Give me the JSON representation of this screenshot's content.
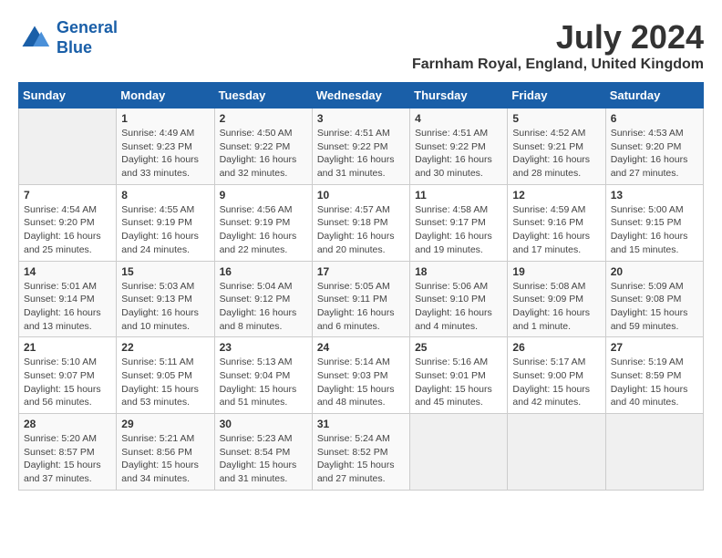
{
  "header": {
    "logo_line1": "General",
    "logo_line2": "Blue",
    "month": "July 2024",
    "location": "Farnham Royal, England, United Kingdom"
  },
  "weekdays": [
    "Sunday",
    "Monday",
    "Tuesday",
    "Wednesday",
    "Thursday",
    "Friday",
    "Saturday"
  ],
  "weeks": [
    [
      {
        "day": "",
        "info": ""
      },
      {
        "day": "1",
        "info": "Sunrise: 4:49 AM\nSunset: 9:23 PM\nDaylight: 16 hours\nand 33 minutes."
      },
      {
        "day": "2",
        "info": "Sunrise: 4:50 AM\nSunset: 9:22 PM\nDaylight: 16 hours\nand 32 minutes."
      },
      {
        "day": "3",
        "info": "Sunrise: 4:51 AM\nSunset: 9:22 PM\nDaylight: 16 hours\nand 31 minutes."
      },
      {
        "day": "4",
        "info": "Sunrise: 4:51 AM\nSunset: 9:22 PM\nDaylight: 16 hours\nand 30 minutes."
      },
      {
        "day": "5",
        "info": "Sunrise: 4:52 AM\nSunset: 9:21 PM\nDaylight: 16 hours\nand 28 minutes."
      },
      {
        "day": "6",
        "info": "Sunrise: 4:53 AM\nSunset: 9:20 PM\nDaylight: 16 hours\nand 27 minutes."
      }
    ],
    [
      {
        "day": "7",
        "info": "Sunrise: 4:54 AM\nSunset: 9:20 PM\nDaylight: 16 hours\nand 25 minutes."
      },
      {
        "day": "8",
        "info": "Sunrise: 4:55 AM\nSunset: 9:19 PM\nDaylight: 16 hours\nand 24 minutes."
      },
      {
        "day": "9",
        "info": "Sunrise: 4:56 AM\nSunset: 9:19 PM\nDaylight: 16 hours\nand 22 minutes."
      },
      {
        "day": "10",
        "info": "Sunrise: 4:57 AM\nSunset: 9:18 PM\nDaylight: 16 hours\nand 20 minutes."
      },
      {
        "day": "11",
        "info": "Sunrise: 4:58 AM\nSunset: 9:17 PM\nDaylight: 16 hours\nand 19 minutes."
      },
      {
        "day": "12",
        "info": "Sunrise: 4:59 AM\nSunset: 9:16 PM\nDaylight: 16 hours\nand 17 minutes."
      },
      {
        "day": "13",
        "info": "Sunrise: 5:00 AM\nSunset: 9:15 PM\nDaylight: 16 hours\nand 15 minutes."
      }
    ],
    [
      {
        "day": "14",
        "info": "Sunrise: 5:01 AM\nSunset: 9:14 PM\nDaylight: 16 hours\nand 13 minutes."
      },
      {
        "day": "15",
        "info": "Sunrise: 5:03 AM\nSunset: 9:13 PM\nDaylight: 16 hours\nand 10 minutes."
      },
      {
        "day": "16",
        "info": "Sunrise: 5:04 AM\nSunset: 9:12 PM\nDaylight: 16 hours\nand 8 minutes."
      },
      {
        "day": "17",
        "info": "Sunrise: 5:05 AM\nSunset: 9:11 PM\nDaylight: 16 hours\nand 6 minutes."
      },
      {
        "day": "18",
        "info": "Sunrise: 5:06 AM\nSunset: 9:10 PM\nDaylight: 16 hours\nand 4 minutes."
      },
      {
        "day": "19",
        "info": "Sunrise: 5:08 AM\nSunset: 9:09 PM\nDaylight: 16 hours\nand 1 minute."
      },
      {
        "day": "20",
        "info": "Sunrise: 5:09 AM\nSunset: 9:08 PM\nDaylight: 15 hours\nand 59 minutes."
      }
    ],
    [
      {
        "day": "21",
        "info": "Sunrise: 5:10 AM\nSunset: 9:07 PM\nDaylight: 15 hours\nand 56 minutes."
      },
      {
        "day": "22",
        "info": "Sunrise: 5:11 AM\nSunset: 9:05 PM\nDaylight: 15 hours\nand 53 minutes."
      },
      {
        "day": "23",
        "info": "Sunrise: 5:13 AM\nSunset: 9:04 PM\nDaylight: 15 hours\nand 51 minutes."
      },
      {
        "day": "24",
        "info": "Sunrise: 5:14 AM\nSunset: 9:03 PM\nDaylight: 15 hours\nand 48 minutes."
      },
      {
        "day": "25",
        "info": "Sunrise: 5:16 AM\nSunset: 9:01 PM\nDaylight: 15 hours\nand 45 minutes."
      },
      {
        "day": "26",
        "info": "Sunrise: 5:17 AM\nSunset: 9:00 PM\nDaylight: 15 hours\nand 42 minutes."
      },
      {
        "day": "27",
        "info": "Sunrise: 5:19 AM\nSunset: 8:59 PM\nDaylight: 15 hours\nand 40 minutes."
      }
    ],
    [
      {
        "day": "28",
        "info": "Sunrise: 5:20 AM\nSunset: 8:57 PM\nDaylight: 15 hours\nand 37 minutes."
      },
      {
        "day": "29",
        "info": "Sunrise: 5:21 AM\nSunset: 8:56 PM\nDaylight: 15 hours\nand 34 minutes."
      },
      {
        "day": "30",
        "info": "Sunrise: 5:23 AM\nSunset: 8:54 PM\nDaylight: 15 hours\nand 31 minutes."
      },
      {
        "day": "31",
        "info": "Sunrise: 5:24 AM\nSunset: 8:52 PM\nDaylight: 15 hours\nand 27 minutes."
      },
      {
        "day": "",
        "info": ""
      },
      {
        "day": "",
        "info": ""
      },
      {
        "day": "",
        "info": ""
      }
    ]
  ]
}
